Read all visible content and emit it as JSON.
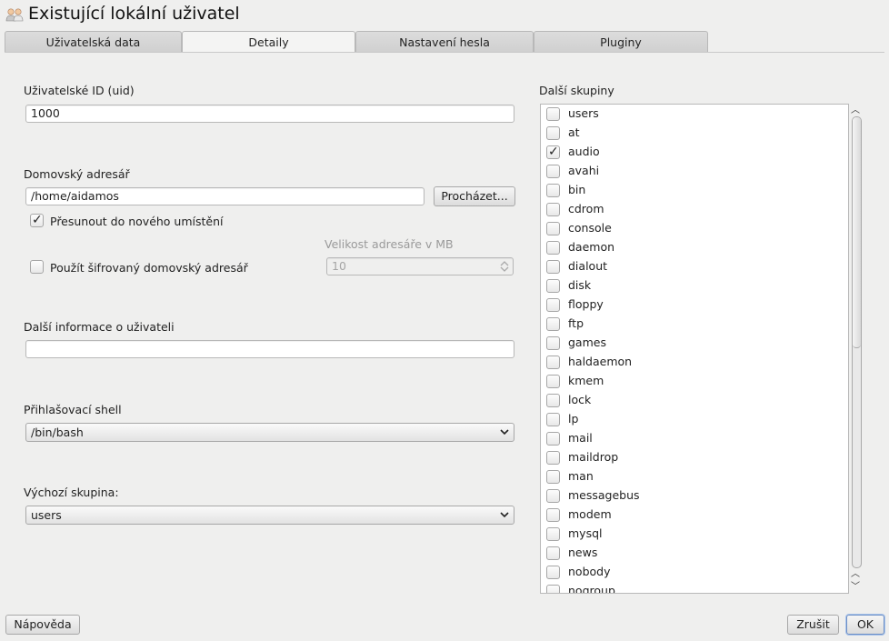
{
  "window": {
    "title": "Existující lokální uživatel",
    "icon": "users-icon"
  },
  "tabs": [
    {
      "label": "Uživatelská data",
      "active": false
    },
    {
      "label": "Detaily",
      "active": true
    },
    {
      "label": "Nastavení hesla",
      "active": false
    },
    {
      "label": "Pluginy",
      "active": false
    }
  ],
  "details": {
    "uid_label": "Uživatelské ID (uid)",
    "uid_value": "1000",
    "home_label": "Domovský adresář",
    "home_value": "/home/aidamos",
    "browse_button": "Procházet...",
    "move_label": "Přesunout do nového umístění",
    "move_checked": true,
    "dir_size_label": "Velikost adresáře v MB",
    "dir_size_value": "10",
    "encrypted_label": "Použít šifrovaný domovský adresář",
    "encrypted_checked": false,
    "extra_info_label": "Další informace o uživateli",
    "extra_info_value": "",
    "shell_label": "Přihlašovací shell",
    "shell_value": "/bin/bash",
    "default_group_label": "Výchozí skupina:",
    "default_group_value": "users"
  },
  "groups": {
    "label": "Další skupiny",
    "items": [
      {
        "name": "users",
        "checked": false
      },
      {
        "name": "at",
        "checked": false
      },
      {
        "name": "audio",
        "checked": true
      },
      {
        "name": "avahi",
        "checked": false
      },
      {
        "name": "bin",
        "checked": false
      },
      {
        "name": "cdrom",
        "checked": false
      },
      {
        "name": "console",
        "checked": false
      },
      {
        "name": "daemon",
        "checked": false
      },
      {
        "name": "dialout",
        "checked": false
      },
      {
        "name": "disk",
        "checked": false
      },
      {
        "name": "floppy",
        "checked": false
      },
      {
        "name": "ftp",
        "checked": false
      },
      {
        "name": "games",
        "checked": false
      },
      {
        "name": "haldaemon",
        "checked": false
      },
      {
        "name": "kmem",
        "checked": false
      },
      {
        "name": "lock",
        "checked": false
      },
      {
        "name": "lp",
        "checked": false
      },
      {
        "name": "mail",
        "checked": false
      },
      {
        "name": "maildrop",
        "checked": false
      },
      {
        "name": "man",
        "checked": false
      },
      {
        "name": "messagebus",
        "checked": false
      },
      {
        "name": "modem",
        "checked": false
      },
      {
        "name": "mysql",
        "checked": false
      },
      {
        "name": "news",
        "checked": false
      },
      {
        "name": "nobody",
        "checked": false
      },
      {
        "name": "nogroup",
        "checked": false
      }
    ]
  },
  "footer": {
    "help_button": "Nápověda",
    "cancel_button": "Zrušit",
    "ok_button": "OK"
  }
}
